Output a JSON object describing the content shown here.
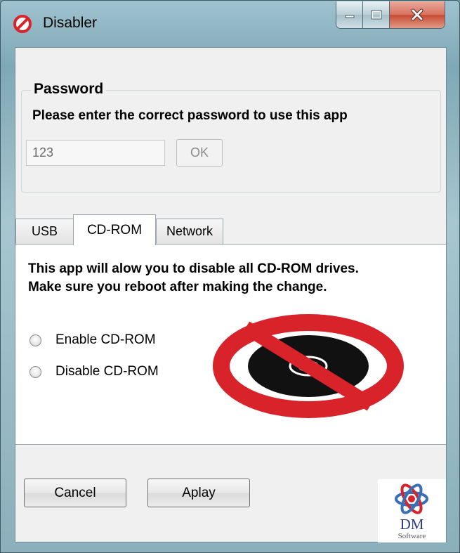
{
  "window": {
    "title": "Disabler",
    "icon": "no-entry-icon"
  },
  "caption_buttons": {
    "minimize": "minimize-icon",
    "maximize": "maximize-icon",
    "close": "close-icon"
  },
  "password": {
    "group_title": "Password",
    "description": "Please enter the correct password to use this app",
    "value": "123",
    "ok_label": "OK"
  },
  "tabs": [
    {
      "label": "USB",
      "selected": false
    },
    {
      "label": "CD-ROM",
      "selected": true
    },
    {
      "label": "Network",
      "selected": false
    }
  ],
  "cdrom_panel": {
    "line1": "This app will alow you to disable all CD-ROM drives.",
    "line2": "Make sure you reboot after making the change.",
    "options": [
      {
        "label": "Enable CD-ROM",
        "checked": false
      },
      {
        "label": "Disable CD-ROM",
        "checked": false
      }
    ],
    "image": "no-cd-icon"
  },
  "buttons": {
    "cancel": "Cancel",
    "apply": "Aplay"
  },
  "logo": {
    "name": "DM",
    "sub": "Software"
  },
  "colors": {
    "prohibition_red": "#d8232a",
    "disc": "#111111",
    "logo_blue": "#2f3a86"
  }
}
